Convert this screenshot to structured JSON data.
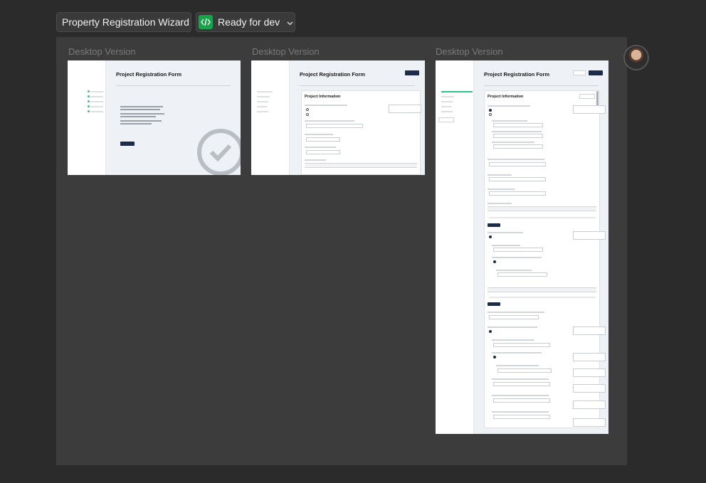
{
  "toolbar": {
    "title": "Property Registration Wizard",
    "status_label": "Ready for dev",
    "status_icon": "code-icon",
    "status_color": "#16a34a"
  },
  "frames": [
    {
      "label": "Desktop Version",
      "form_title": "Project Registration Form"
    },
    {
      "label": "Desktop Version",
      "form_title": "Project Registration Form",
      "section_title": "Project Information"
    },
    {
      "label": "Desktop Version",
      "form_title": "Project Registration Form",
      "section_title": "Project Information"
    }
  ],
  "colors": {
    "background": "#2b2b2b",
    "canvas": "#3c3c3c",
    "primary_button": "#1e2a4a",
    "progress": "#2fc48a"
  }
}
